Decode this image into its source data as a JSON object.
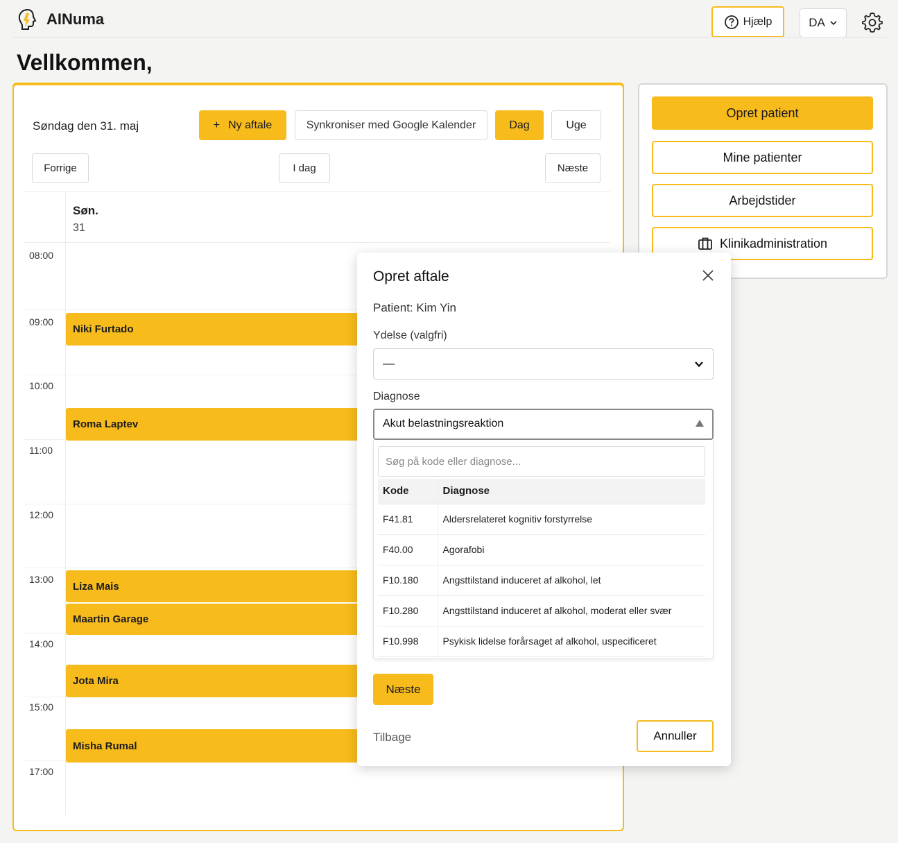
{
  "header": {
    "app_title": "AINuma",
    "help_label": "Hjælp",
    "lang_label": "DA"
  },
  "welcome": "Vellkommen,",
  "calendar": {
    "date_label": "Søndag den 31. maj",
    "new_label": "Ny aftale",
    "new_plus": "+",
    "sync_label": "Synkroniser med Google Kalender",
    "day_label": "Dag",
    "week_label": "Uge",
    "prev_label": "Forrige",
    "today_label": "I dag",
    "next_label": "Næste",
    "day_name": "Søn.",
    "day_num": "31",
    "times": [
      "08:00",
      "09:00",
      "10:00",
      "11:00",
      "12:00",
      "13:00",
      "14:00",
      "15:00",
      "17:00"
    ],
    "appointments": [
      "Niki Furtado",
      "Roma Laptev",
      "Liza Mais",
      "Maartin Garage",
      "Jota Mira",
      "Misha Rumal"
    ]
  },
  "side": {
    "create_patient": "Opret patient",
    "my_patients": "Mine patienter",
    "work_hours": "Arbejdstider",
    "clinic_admin": "Klinikadministration"
  },
  "modal": {
    "title": "Opret aftale",
    "patient_label": "Patient: Kim Yin",
    "service_label": "Ydelse (valgfri)",
    "service_value": "—",
    "diagnosis_label": "Diagnose",
    "diagnosis_value": "Akut belastningsreaktion",
    "search_placeholder": "Søg på kode eller diagnose...",
    "table_headers": {
      "code": "Kode",
      "diagnosis": "Diagnose"
    },
    "rows": [
      {
        "code": "F41.81",
        "diagnosis": "Aldersrelateret kognitiv forstyrrelse"
      },
      {
        "code": "F40.00",
        "diagnosis": "Agorafobi"
      },
      {
        "code": "F10.180",
        "diagnosis": "Angsttilstand induceret af alkohol, let"
      },
      {
        "code": "F10.280",
        "diagnosis": "Angsttilstand induceret af alkohol, moderat eller svær"
      },
      {
        "code": "F10.998",
        "diagnosis": "Psykisk lidelse forårsaget af alkohol, uspecificeret"
      }
    ],
    "next_label": "Næste",
    "back_label": "Tilbage",
    "cancel_label": "Annuller"
  },
  "colors": {
    "accent": "#f7bb1c",
    "border_grey": "#d8d8d8"
  }
}
